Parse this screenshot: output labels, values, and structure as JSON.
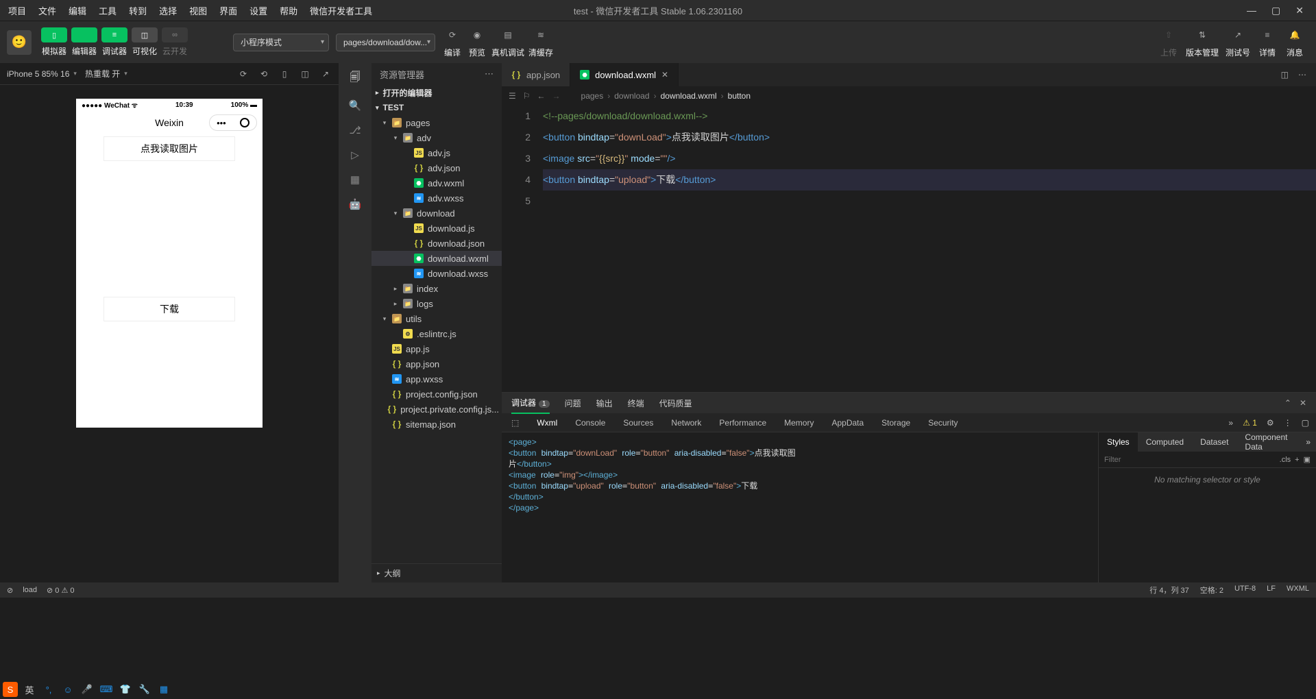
{
  "titlebar": {
    "menus": [
      "项目",
      "文件",
      "编辑",
      "工具",
      "转到",
      "选择",
      "视图",
      "界面",
      "设置",
      "帮助",
      "微信开发者工具"
    ],
    "title": "test - 微信开发者工具 Stable 1.06.2301160"
  },
  "toolbar": {
    "groups": [
      {
        "icon": "▯",
        "cls": "green",
        "label": "模拟器"
      },
      {
        "icon": "</>",
        "cls": "green",
        "label": "编辑器"
      },
      {
        "icon": "≡",
        "cls": "green",
        "label": "调试器"
      },
      {
        "icon": "◫",
        "cls": "grey",
        "label": "可视化"
      },
      {
        "icon": "∞",
        "cls": "grey-dis",
        "label": "云开发"
      }
    ],
    "mode": "小程序模式",
    "page_dd": "pages/download/dow...",
    "actions": [
      {
        "icon": "⟳",
        "label": "编译"
      },
      {
        "icon": "◉",
        "label": "预览"
      },
      {
        "icon": "▤",
        "label": "真机调试"
      },
      {
        "icon": "≋",
        "label": "清缓存"
      }
    ],
    "right": [
      {
        "icon": "⇧",
        "label": "上传",
        "dis": true
      },
      {
        "icon": "⇅",
        "label": "版本管理"
      },
      {
        "icon": "↗",
        "label": "测试号"
      },
      {
        "icon": "≡",
        "label": "详情"
      },
      {
        "icon": "🔔",
        "label": "消息"
      }
    ]
  },
  "sim": {
    "device": "iPhone 5 85% 16",
    "reload": "热重载 开",
    "status_left": "●●●●● WeChat ᯤ",
    "status_time": "10:39",
    "status_right": "100% ▬",
    "nav_title": "Weixin",
    "btn1": "点我读取图片",
    "btn2": "下载"
  },
  "explorer": {
    "title": "资源管理器",
    "sec1": "打开的编辑器",
    "sec2": "TEST",
    "outline": "大纲",
    "tree": [
      {
        "d": 0,
        "open": true,
        "icon": "fold",
        "name": "pages"
      },
      {
        "d": 1,
        "open": true,
        "icon": "foldg",
        "name": "adv"
      },
      {
        "d": 2,
        "icon": "js",
        "name": "adv.js"
      },
      {
        "d": 2,
        "icon": "jsonc",
        "name": "adv.json"
      },
      {
        "d": 2,
        "icon": "wxml",
        "name": "adv.wxml"
      },
      {
        "d": 2,
        "icon": "wxss",
        "name": "adv.wxss"
      },
      {
        "d": 1,
        "open": true,
        "icon": "foldg",
        "name": "download"
      },
      {
        "d": 2,
        "icon": "js",
        "name": "download.js"
      },
      {
        "d": 2,
        "icon": "jsonc",
        "name": "download.json"
      },
      {
        "d": 2,
        "icon": "wxml",
        "name": "download.wxml",
        "sel": true
      },
      {
        "d": 2,
        "icon": "wxss",
        "name": "download.wxss"
      },
      {
        "d": 1,
        "closed": true,
        "icon": "foldg",
        "name": "index"
      },
      {
        "d": 1,
        "closed": true,
        "icon": "foldg",
        "name": "logs"
      },
      {
        "d": 0,
        "open": true,
        "icon": "fold",
        "name": "utils"
      },
      {
        "d": 1,
        "icon": "js",
        "name": ".eslintrc.js",
        "eslint": true
      },
      {
        "d": 0,
        "icon": "js",
        "name": "app.js"
      },
      {
        "d": 0,
        "icon": "jsonc",
        "name": "app.json"
      },
      {
        "d": 0,
        "icon": "wxss",
        "name": "app.wxss"
      },
      {
        "d": 0,
        "icon": "jsonc",
        "name": "project.config.json"
      },
      {
        "d": 0,
        "icon": "jsonc",
        "name": "project.private.config.js..."
      },
      {
        "d": 0,
        "icon": "jsonc",
        "name": "sitemap.json"
      }
    ]
  },
  "tabs": [
    {
      "icon": "jsonc",
      "name": "app.json"
    },
    {
      "icon": "wxml",
      "name": "download.wxml",
      "active": true
    }
  ],
  "breadcrumb": [
    "pages",
    "download",
    "download.wxml",
    "button"
  ],
  "code": {
    "lines": [
      {
        "n": 1,
        "html": "<span class='c-cm'>&lt;!--pages/download/download.wxml--&gt;</span>"
      },
      {
        "n": 2,
        "html": "<span class='c-tag'>&lt;button</span> <span class='c-attr'>bindtap</span>=<span class='c-str'>\"downLoad\"</span><span class='c-tag'>&gt;</span><span class='c-txt'>点我读取图片</span><span class='c-tag'>&lt;/button&gt;</span>"
      },
      {
        "n": 3,
        "html": "<span class='c-tag'>&lt;image</span> <span class='c-attr'>src</span>=<span class='c-str'>\"</span><span class='c-bind'>{{src}}</span><span class='c-str'>\"</span> <span class='c-attr'>mode</span>=<span class='c-str'>\"\"</span><span class='c-tag'>/&gt;</span>"
      },
      {
        "n": 4,
        "hl": true,
        "html": "<span class='c-tag'>&lt;button</span> <span class='c-attr'>bindtap</span>=<span class='c-str'>\"upload\"</span><span class='c-tag'>&gt;</span><span class='c-txt'>下载</span><span class='c-tag'>&lt;/button&gt;</span>"
      },
      {
        "n": 5,
        "html": ""
      }
    ]
  },
  "debug": {
    "tabs": [
      "调试器",
      "问题",
      "输出",
      "终端",
      "代码质量"
    ],
    "devtabs": [
      "Wxml",
      "Console",
      "Sources",
      "Network",
      "Performance",
      "Memory",
      "AppData",
      "Storage",
      "Security"
    ],
    "warn": "1",
    "elements": "<span class='e-tag'>&lt;page&gt;</span>\n  <span class='e-tag'>&lt;button</span> <span class='e-attr'>bindtap</span>=<span class='e-str'>\"downLoad\"</span> <span class='e-attr'>role</span>=<span class='e-str'>\"button\"</span> <span class='e-attr'>aria-disabled</span>=<span class='e-str'>\"false\"</span><span class='e-tag'>&gt;</span>点我读取图\n片<span class='e-tag'>&lt;/button&gt;</span>\n  <span class='e-tag'>&lt;image</span> <span class='e-attr'>role</span>=<span class='e-str'>\"img\"</span><span class='e-tag'>&gt;&lt;/image&gt;</span>\n  <span class='e-tag'>&lt;button</span> <span class='e-attr'>bindtap</span>=<span class='e-str'>\"upload\"</span> <span class='e-attr'>role</span>=<span class='e-str'>\"button\"</span> <span class='e-attr'>aria-disabled</span>=<span class='e-str'>\"false\"</span><span class='e-tag'>&gt;</span>下载\n  <span class='e-tag'>&lt;/button&gt;</span>\n<span class='e-tag'>&lt;/page&gt;</span>",
    "styles_tabs": [
      "Styles",
      "Computed",
      "Dataset",
      "Component Data"
    ],
    "filter_ph": "Filter",
    "cls": ".cls",
    "nomatch": "No matching selector or style"
  },
  "status": {
    "left": [
      "load",
      "⊘ 0 ⚠ 0"
    ],
    "right": [
      "行 4，列 37",
      "空格: 2",
      "UTF-8",
      "LF",
      "WXML"
    ]
  }
}
